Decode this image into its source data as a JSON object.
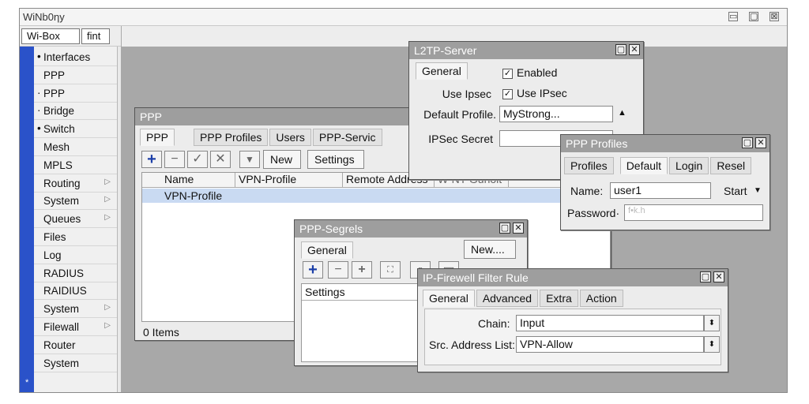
{
  "app": {
    "title": "WiNb0ηy",
    "window_controls": [
      "▭",
      "▢",
      "⊠"
    ]
  },
  "toolbar": {
    "winbox_label": "Wi-Box",
    "fint_label": "fint"
  },
  "sidebar": {
    "strip_mark": "*",
    "items": [
      {
        "label": "Interfaces",
        "bullet": "•",
        "arrow": ""
      },
      {
        "label": "PPP",
        "bullet": "",
        "arrow": ""
      },
      {
        "label": "PPP",
        "bullet": "·",
        "arrow": ""
      },
      {
        "label": "Bridge",
        "bullet": "·",
        "arrow": ""
      },
      {
        "label": "Switch",
        "bullet": "•",
        "arrow": ""
      },
      {
        "label": "Mesh",
        "bullet": "",
        "arrow": ""
      },
      {
        "label": "MPLS",
        "bullet": "",
        "arrow": ""
      },
      {
        "label": "Routing",
        "bullet": "",
        "arrow": "▷"
      },
      {
        "label": "System",
        "bullet": "",
        "arrow": "▷"
      },
      {
        "label": "Queues",
        "bullet": "",
        "arrow": "▷"
      },
      {
        "label": "Files",
        "bullet": "",
        "arrow": ""
      },
      {
        "label": "Log",
        "bullet": "",
        "arrow": ""
      },
      {
        "label": "RADIUS",
        "bullet": "",
        "arrow": ""
      },
      {
        "label": "RAIDIUS",
        "bullet": "",
        "arrow": ""
      },
      {
        "label": "System",
        "bullet": "",
        "arrow": "▷"
      },
      {
        "label": "Filewall",
        "bullet": "",
        "arrow": "▷"
      },
      {
        "label": "Router",
        "bullet": "",
        "arrow": ""
      },
      {
        "label": "System",
        "bullet": "",
        "arrow": ""
      }
    ]
  },
  "ppp": {
    "title": "PPP",
    "tabs": [
      "PPP",
      "PPP Profiles",
      "Users",
      "PPP-Servic"
    ],
    "new_label": "New",
    "settings_label": "Settings",
    "columns": [
      "Name",
      "VPN-Profile",
      "Remote Address",
      "W-NT Gunolt"
    ],
    "rows": [
      {
        "name": "VPN-Profile"
      }
    ],
    "status": "0 Items"
  },
  "l2tp": {
    "title": "L2TP-Server",
    "tab": "General",
    "enabled_label": "Enabled",
    "use_ipsec_label": "Use Ipsec",
    "use_ipsec_check_label": "Use IPsec",
    "default_profile_label": "Default Profile.",
    "default_profile_value": "MyStrong...",
    "ipsec_secret_label": "IPSec Secret"
  },
  "profiles": {
    "title": "PPP Profiles",
    "tabs": [
      "Profiles",
      "Default",
      "Login",
      "Resel"
    ],
    "name_label": "Name:",
    "name_value": "user1",
    "start_label": "Start",
    "password_label": "Password·",
    "password_value": "f•k.h"
  },
  "segrels": {
    "title": "PPP-Segrels",
    "tab": "General",
    "new_label": "New....",
    "settings_label": "Settings"
  },
  "firewall": {
    "title": "IP-Firewell Filter Rule",
    "tabs": [
      "General",
      "Advanced",
      "Extra",
      "Action"
    ],
    "chain_label": "Chain:",
    "chain_value": "Input",
    "src_label": "Src. Address List:",
    "src_value": "VPN-Allow"
  }
}
